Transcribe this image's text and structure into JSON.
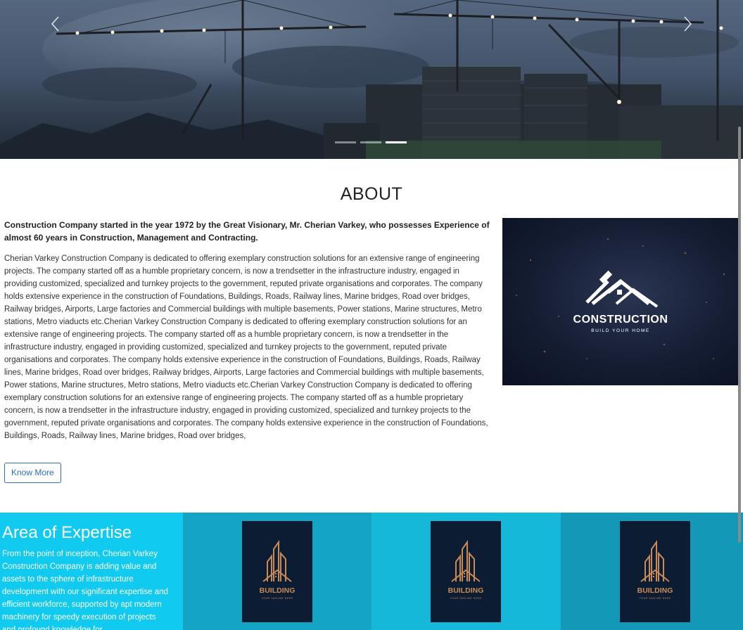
{
  "hero": {
    "prev_icon": "chevron-left-icon",
    "next_icon": "chevron-right-icon",
    "active_slide": 3,
    "slide_count": 3
  },
  "about": {
    "title": "ABOUT",
    "lead": "Construction Company started in the year 1972 by the Great Visionary, Mr. Cherian Varkey, who possesses Experience of almost 60 years in Construction, Management and Contracting.",
    "body": "Cherian Varkey Construction Company is dedicated to offering exemplary construction solutions for an extensive range of engineering projects. The company started off as a humble proprietary concern, is now a trendsetter in the infrastructure industry, engaged in providing customized, specialized and turnkey projects to the government, reputed private organisations and corporates. The company holds extensive experience in the construction of Foundations, Buildings, Roads, Railway lines, Marine bridges, Road over bridges, Railway bridges, Airports, Large factories and Commercial buildings with multiple basements, Power stations, Marine structures, Metro stations, Metro viaducts etc.Cherian Varkey Construction Company is dedicated to offering exemplary construction solutions for an extensive range of engineering projects. The company started off as a humble proprietary concern, is now a trendsetter in the infrastructure industry, engaged in providing customized, specialized and turnkey projects to the government, reputed private organisations and corporates. The company holds extensive experience in the construction of Foundations, Buildings, Roads, Railway lines, Marine bridges, Road over bridges, Railway bridges, Airports, Large factories and Commercial buildings with multiple basements, Power stations, Marine structures, Metro stations, Metro viaducts etc.Cherian Varkey Construction Company is dedicated to offering exemplary construction solutions for an extensive range of engineering projects. The company started off as a humble proprietary concern, is now a trendsetter in the infrastructure industry, engaged in providing customized, specialized and turnkey projects to the government, reputed private organisations and corporates. The company holds extensive experience in the construction of Foundations, Buildings, Roads, Railway lines, Marine bridges, Road over bridges,",
    "button_label": "Know More",
    "logo_word": "CONSTRUCTION",
    "logo_tagline": "BUILD YOUR HOME"
  },
  "expertise": {
    "title": "Area of Expertise",
    "text": "From the point of inception, Cherian Varkey Construction Company is adding value and assets to the sphere of infrastructure development with our significant expertise and efficient workforce, supported by apt modern machinery for speedy execution of projects and profound knowledge for",
    "cards": [
      {
        "word": "BUILDING",
        "tagline": "YOUR TAGLINE HERE",
        "icon": "building-logo-icon"
      },
      {
        "word": "BUILDING",
        "tagline": "YOUR TAGLINE HERE",
        "icon": "building-logo-icon"
      },
      {
        "word": "BUILDING",
        "tagline": "YOUR TAGLINE HERE",
        "icon": "building-logo-icon"
      }
    ]
  },
  "colors": {
    "expertise_intro": "#10cbef",
    "card_1": "#14a5c4",
    "card_2": "#16b8d9",
    "card_3": "#1399b7",
    "button_accent": "#2c6fb7",
    "building_gold": "#c98a56"
  }
}
